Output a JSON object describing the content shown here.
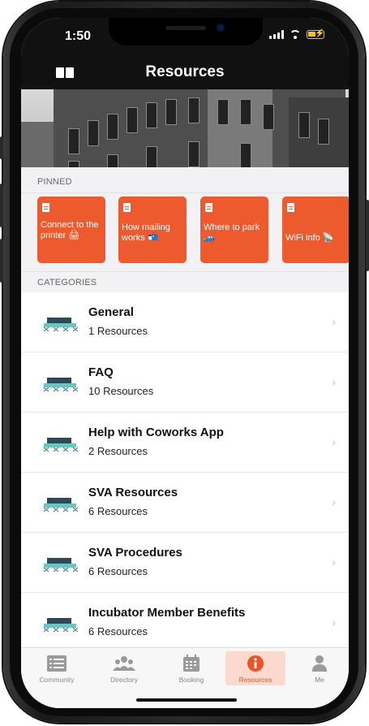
{
  "status_bar": {
    "time": "1:50"
  },
  "header": {
    "title": "Resources"
  },
  "pinned": {
    "label": "PINNED",
    "items": [
      {
        "label": "Connect to the printer 🖨"
      },
      {
        "label": "How mailing works 📬"
      },
      {
        "label": "Where to park 🚙"
      },
      {
        "label": "WiFi info 📡"
      }
    ]
  },
  "categories": {
    "label": "CATEGORIES",
    "items": [
      {
        "title": "General",
        "count": "1 Resources"
      },
      {
        "title": "FAQ",
        "count": "10 Resources"
      },
      {
        "title": "Help with Coworks App",
        "count": "2 Resources"
      },
      {
        "title": "SVA Resources",
        "count": "6 Resources"
      },
      {
        "title": "SVA Procedures",
        "count": "6 Resources"
      },
      {
        "title": "Incubator Member Benefits",
        "count": "6 Resources"
      }
    ]
  },
  "tabbar": {
    "items": [
      {
        "label": "Community"
      },
      {
        "label": "Directory"
      },
      {
        "label": "Booking"
      },
      {
        "label": "Resources"
      },
      {
        "label": "Me"
      }
    ],
    "active": "Resources"
  },
  "colors": {
    "accent": "#ec5a2e",
    "header_bg": "#111111",
    "tab_active_bg": "#fbd9cc"
  }
}
